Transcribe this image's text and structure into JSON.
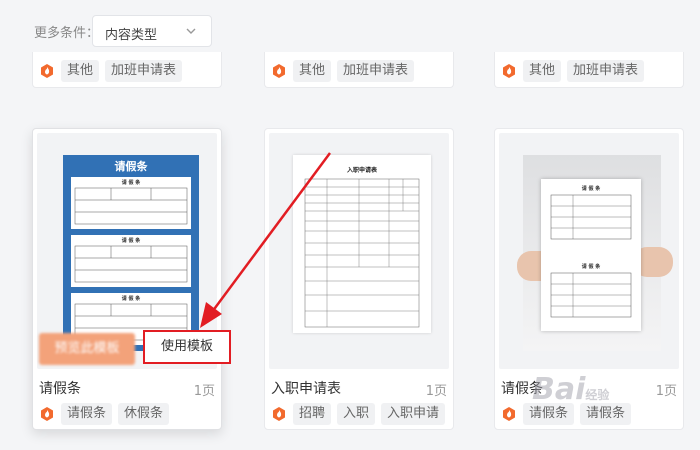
{
  "filter": {
    "label": "更多条件：",
    "select_value": "内容类型"
  },
  "top_row": [
    {
      "tags": [
        "其他",
        "加班申请表"
      ]
    },
    {
      "tags": [
        "其他",
        "加班申请表"
      ]
    },
    {
      "tags": [
        "其他",
        "加班申请表"
      ]
    }
  ],
  "cards": [
    {
      "title": "请假条",
      "pages": "1页",
      "tags": [
        "请假条",
        "休假条"
      ],
      "preview_label": "预览此模板",
      "use_label": "使用模板",
      "thumb_title": "请假条",
      "form_title": "请 假 条"
    },
    {
      "title": "入职申请表",
      "pages": "1页",
      "tags": [
        "招聘",
        "入职",
        "入职申请"
      ],
      "thumb_title": "入职申请表"
    },
    {
      "title": "请假条",
      "pages": "1页",
      "tags": [
        "请假条",
        "请假条"
      ],
      "thumb_title": "请 假 条"
    }
  ],
  "watermark": {
    "text": "Bai",
    "suffix": "经验"
  },
  "colors": {
    "brand": "#f26a2e",
    "highlight": "#e21d23",
    "doc_blue": "#3171b5"
  }
}
